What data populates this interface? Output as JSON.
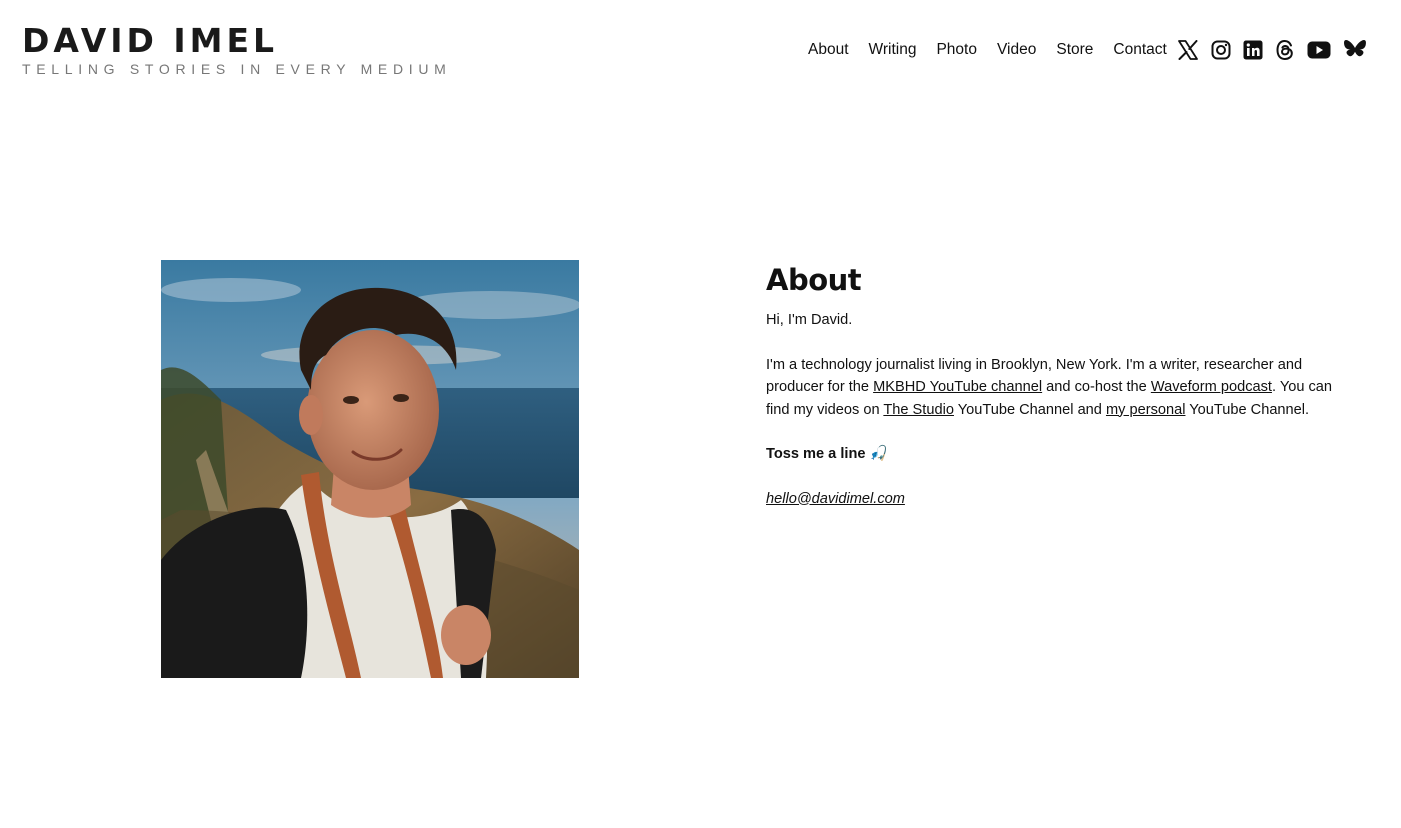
{
  "site": {
    "title": "DAVID IMEL",
    "tagline": "TELLING STORIES IN EVERY MEDIUM"
  },
  "nav": {
    "about": "About",
    "writing": "Writing",
    "photo": "Photo",
    "video": "Video",
    "store": "Store",
    "contact": "Contact"
  },
  "social": [
    "x-icon",
    "instagram-icon",
    "linkedin-icon",
    "threads-icon",
    "youtube-icon",
    "bluesky-icon"
  ],
  "about": {
    "heading": "About",
    "greeting": "Hi, I'm David.",
    "bio_1": "I'm a technology journalist living in Brooklyn, New York. I'm a writer, researcher and producer for the ",
    "link_mkbhd": "MKBHD YouTube channel",
    "bio_2": " and co-host the ",
    "link_waveform": "Waveform podcast",
    "bio_3": ". You can find my videos on ",
    "link_studio": "The Studio",
    "bio_4": " YouTube Channel and ",
    "link_personal": "my personal",
    "bio_5": " YouTube Channel.",
    "toss": "Toss me a line",
    "toss_emoji": "🎣",
    "email": "hello@davidimel.com"
  },
  "colors": {
    "text": "#111111",
    "tagline": "#777777",
    "background": "#ffffff"
  }
}
